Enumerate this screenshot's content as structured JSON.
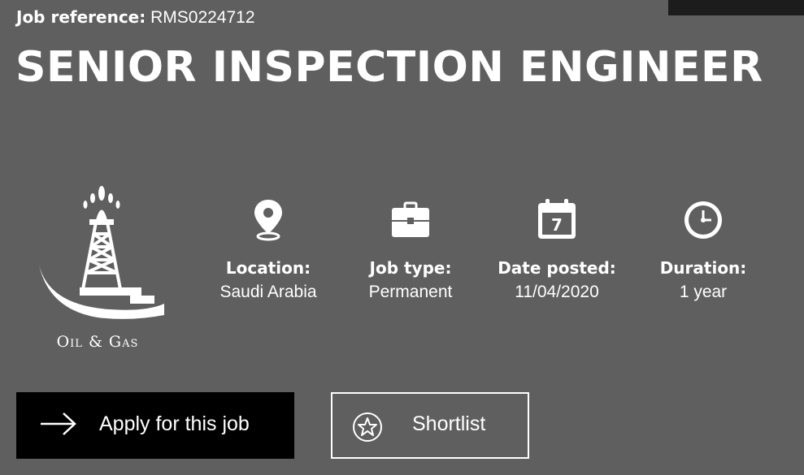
{
  "header": {
    "job_reference_label": "Job reference:",
    "job_reference_value": "RMS0224712",
    "title": "SENIOR INSPECTION ENGINEER"
  },
  "sector": {
    "label": "Oil & Gas",
    "icon": "oil-rig-icon"
  },
  "meta": {
    "location": {
      "label": "Location:",
      "value": "Saudi Arabia",
      "icon": "map-pin-icon"
    },
    "job_type": {
      "label": "Job type:",
      "value": "Permanent",
      "icon": "briefcase-icon"
    },
    "date_posted": {
      "label": "Date posted:",
      "value": "11/04/2020",
      "icon": "calendar-icon",
      "icon_text": "7"
    },
    "duration": {
      "label": "Duration:",
      "value": "1 year",
      "icon": "clock-icon"
    }
  },
  "actions": {
    "apply_label": "Apply for this job",
    "shortlist_label": "Shortlist"
  },
  "colors": {
    "background": "#5e5f5e",
    "apply_button": "#000000",
    "text": "#ffffff"
  }
}
